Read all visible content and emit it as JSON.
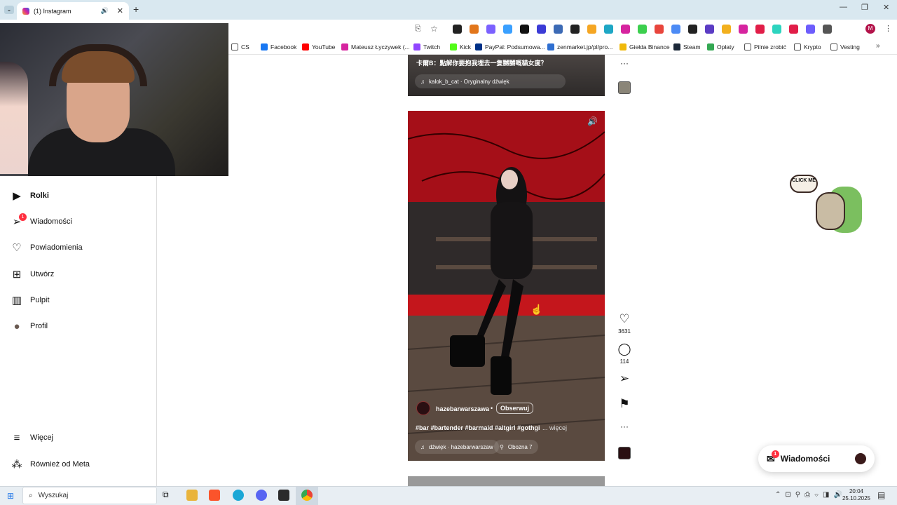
{
  "browser": {
    "tab_title": "(1) Instagram",
    "new_tab": "+",
    "close_tab": "✕",
    "audio_icon": "🔊",
    "window_controls": {
      "minimize": "—",
      "restore": "❐",
      "close": "✕"
    }
  },
  "bookmarks": [
    {
      "label": "CS",
      "color": "#ffffff"
    },
    {
      "label": "Facebook",
      "color": "#1877f2"
    },
    {
      "label": "YouTube",
      "color": "#ff0000"
    },
    {
      "label": "Mateusz Łyczywek (...",
      "color": "#d6249f"
    },
    {
      "label": "Twitch",
      "color": "#9146ff"
    },
    {
      "label": "Kick",
      "color": "#53fc18"
    },
    {
      "label": "PayPal: Podsumowa...",
      "color": "#003087"
    },
    {
      "label": "zenmarket.jp/pl/pro...",
      "color": "#2f6fd1"
    },
    {
      "label": "Giełda Binance",
      "color": "#f0b90b"
    },
    {
      "label": "Steam",
      "color": "#1b2838"
    },
    {
      "label": "Opłaty",
      "color": "#34a853"
    },
    {
      "label": "Pilnie zrobić",
      "color": "#ffffff"
    },
    {
      "label": "Krypto",
      "color": "#ffffff"
    },
    {
      "label": "Vesting",
      "color": "#ffffff"
    }
  ],
  "sidebar": {
    "items": [
      {
        "label": "Rolki",
        "icon": "reels-icon",
        "glyph": "▶"
      },
      {
        "label": "Wiadomości",
        "icon": "messages-icon",
        "glyph": "➢",
        "badge": "1"
      },
      {
        "label": "Powiadomienia",
        "icon": "heart-icon",
        "glyph": "♡"
      },
      {
        "label": "Utwórz",
        "icon": "create-icon",
        "glyph": "⊞"
      },
      {
        "label": "Pulpit",
        "icon": "dashboard-icon",
        "glyph": "▥"
      },
      {
        "label": "Profil",
        "icon": "profile-avatar",
        "glyph": "●"
      },
      {
        "label": "Więcej",
        "icon": "menu-icon",
        "glyph": "≡"
      },
      {
        "label": "Również od Meta",
        "icon": "meta-icon",
        "glyph": "⁂"
      }
    ]
  },
  "reel_top": {
    "caption": "卡爾B：點解你要抱我埋去一隻嬲嬲嘅貓女度？",
    "audio": "kalok_b_cat · Oryginalny dźwięk"
  },
  "reel_main": {
    "username": "hazebarwarszawa",
    "dot": "•",
    "follow": "Obserwuj",
    "caption": "#bar #bartender #barmaid #altgirl #gothgi",
    "more": "... więcej",
    "audio": "dźwięk · hazebarwarszaw",
    "location": "Obozna 7",
    "likes": "3631",
    "comments": "114"
  },
  "messages_widget": {
    "label": "Wiadomości",
    "badge": "1"
  },
  "sticker": {
    "text": "CLICK ME"
  },
  "taskbar": {
    "search": "Wyszukaj",
    "time": "20:04",
    "date": "25.10.2025"
  }
}
